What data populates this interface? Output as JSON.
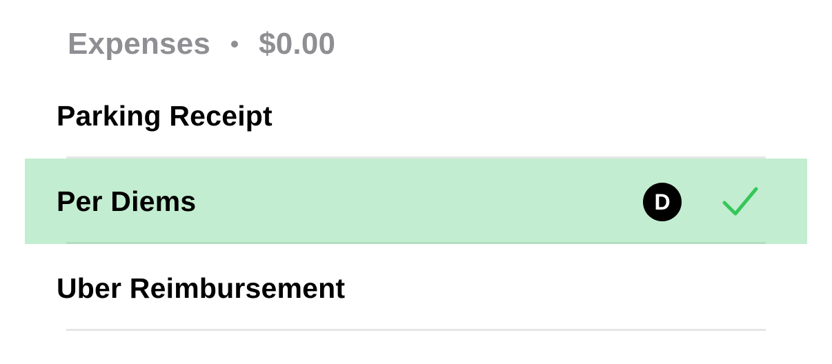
{
  "header": {
    "title": "Expenses",
    "separator": "•",
    "total": "$0.00"
  },
  "items": [
    {
      "label": "Parking Receipt",
      "selected": false
    },
    {
      "label": "Per Diems",
      "selected": true,
      "avatar_initial": "D"
    },
    {
      "label": "Uber Reimbursement",
      "selected": false
    }
  ],
  "colors": {
    "selected_background": "#c3edd0",
    "check": "#34c759",
    "header_text": "#8e8e93",
    "avatar_background": "#000000"
  },
  "icons": {
    "selection": "checkmark-icon"
  }
}
